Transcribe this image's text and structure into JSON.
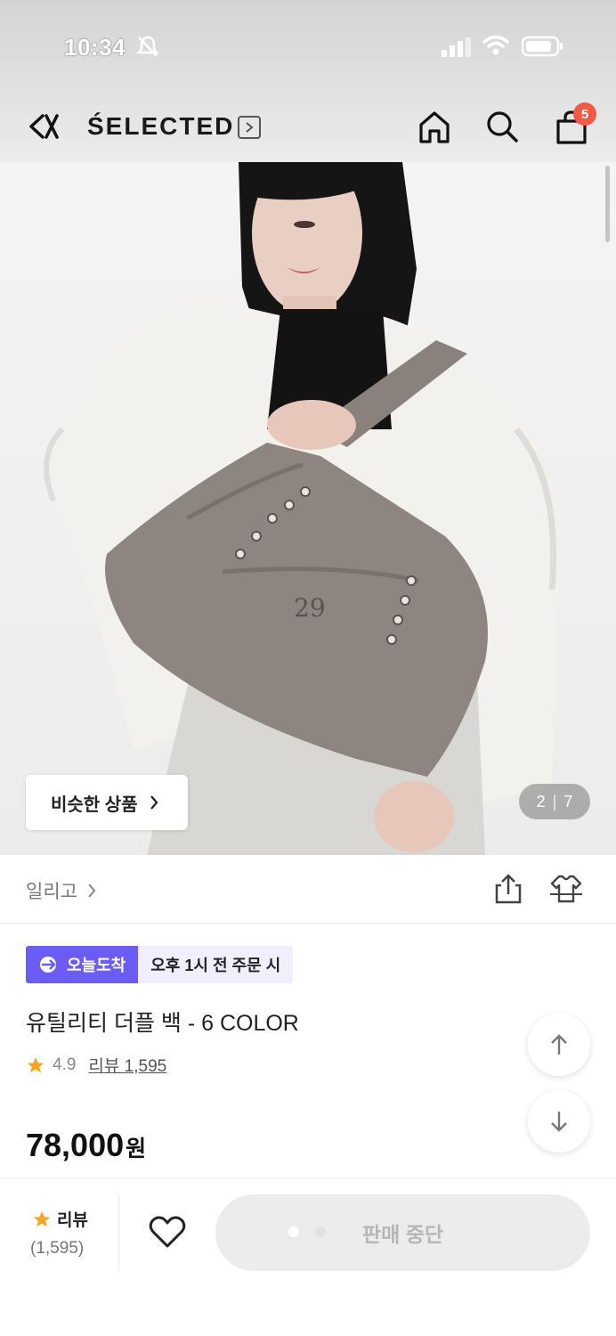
{
  "status_bar": {
    "time": "10:34"
  },
  "header": {
    "brand": "ŚELECTED",
    "cart_count": "5"
  },
  "hero": {
    "similar_label": "비슷한 상품",
    "counter": {
      "current": "2",
      "separator": "|",
      "total": "7"
    }
  },
  "shop": {
    "name": "일리고"
  },
  "product": {
    "delivery_tag": "오늘도착",
    "delivery_condition": "오후 1시 전 주문 시",
    "title": "유틸리티 더플 백 - 6 COLOR",
    "rating": "4.9",
    "reviews_label": "리뷰 1,595",
    "price": "78,000",
    "currency": "원"
  },
  "bottom_bar": {
    "review_label": "리뷰",
    "review_count": "(1,595)",
    "soldout_label": "판매 중단"
  },
  "colors": {
    "accent": "#6b5cf6",
    "badge": "#f05a46",
    "star": "#f5a524"
  }
}
